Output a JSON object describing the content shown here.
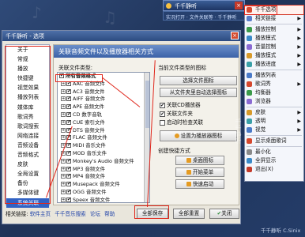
{
  "player": {
    "title": "千千静听",
    "lyric": "实况打开 · 文件关联等 · 千千静听"
  },
  "dialog": {
    "title": "千千静听 - 选项",
    "close": "×"
  },
  "nav": {
    "items": [
      {
        "label": "关于",
        "selected": false
      },
      {
        "label": "常规",
        "selected": false
      },
      {
        "label": "播放",
        "selected": false
      },
      {
        "label": "快捷键",
        "selected": false
      },
      {
        "label": "视觉效果",
        "selected": false
      },
      {
        "label": "播放列表",
        "selected": false
      },
      {
        "label": "媒体库",
        "selected": false
      },
      {
        "label": "歌词秀",
        "selected": false
      },
      {
        "label": "歌词搜索",
        "selected": false
      },
      {
        "label": "网络连接",
        "selected": false
      },
      {
        "label": "音频设备",
        "selected": false
      },
      {
        "label": "音频格式",
        "selected": false
      },
      {
        "label": "皮肤",
        "selected": false
      },
      {
        "label": "全局设置",
        "selected": false
      },
      {
        "label": "备份",
        "selected": false
      },
      {
        "label": "多媒体键",
        "selected": false
      },
      {
        "label": "系统关联",
        "selected": true
      }
    ]
  },
  "panel": {
    "header": "关联音频文件以及播放器相关方式",
    "types_label": "关联文件类型:",
    "icon_label": "当前文件类型的图标",
    "choose_icon": "选择文件图标",
    "restore_icon": "从文件夹里自动选择图标",
    "checks": [
      {
        "label": "关联CD播放器",
        "checked": true
      },
      {
        "label": "关联文件夹",
        "checked": true
      },
      {
        "label": "启动时检查关联",
        "checked": false
      }
    ],
    "headphone_btn": "设置为播放器图标",
    "shortcut_label": "创建快捷方式",
    "shortcut_desktop": "桌面图标",
    "shortcut_start": "开始菜单",
    "shortcut_quick": "快速启动",
    "list": [
      {
        "label": "所有音频格式",
        "top": true
      },
      {
        "label": "AAC 音频文件"
      },
      {
        "label": "AC3 音频文件"
      },
      {
        "label": "AIFF 音频文件"
      },
      {
        "label": "APE 音频文件"
      },
      {
        "label": "CD 数字音轨"
      },
      {
        "label": "CUE 索引文件"
      },
      {
        "label": "DTS 音频文件"
      },
      {
        "label": "FLAC 音频文件"
      },
      {
        "label": "MIDI 音乐文件"
      },
      {
        "label": "MOD 音乐文件"
      },
      {
        "label": "Monkey's Audio 音频文件"
      },
      {
        "label": "MP3 音频文件"
      },
      {
        "label": "MP4 音频文件"
      },
      {
        "label": "Musepack 音频文件"
      },
      {
        "label": "OGG 音频文件"
      },
      {
        "label": "Speex 音频文件"
      }
    ]
  },
  "footer": {
    "label": "相关链接:",
    "links": [
      "软件主页",
      "千千音乐搜索",
      "论坛",
      "帮助"
    ],
    "save_all": "全部保存",
    "reset_all": "全部重置",
    "close": "关闭"
  },
  "menu": {
    "items": [
      {
        "label": "千千选项",
        "arrow": false,
        "hl": true,
        "color": "#d6482e"
      },
      {
        "label": "相关链接",
        "arrow": true,
        "color": "#5a7dc8"
      },
      {
        "sep": true
      },
      {
        "label": "播放控制",
        "arrow": true,
        "color": "#3a9a4a"
      },
      {
        "label": "播放模式",
        "arrow": true,
        "color": "#3a8ac8"
      },
      {
        "label": "音量控制",
        "arrow": true,
        "color": "#8a6ad2"
      },
      {
        "label": "播放模式",
        "arrow": true,
        "color": "#d89a2a"
      },
      {
        "label": "播放进度",
        "arrow": true,
        "color": "#3aa0a8"
      },
      {
        "sep": true
      },
      {
        "label": "播放列表",
        "arrow": false,
        "color": "#4a7ac8"
      },
      {
        "label": "歌词秀",
        "arrow": true,
        "color": "#d6482e"
      },
      {
        "label": "均衡器",
        "arrow": false,
        "color": "#3a9a4a"
      },
      {
        "label": "浏览器",
        "arrow": false,
        "color": "#8a6ad2"
      },
      {
        "sep": true
      },
      {
        "label": "皮肤",
        "arrow": true,
        "color": "#d89a2a"
      },
      {
        "label": "透明",
        "arrow": true,
        "color": "#3aa0a8"
      },
      {
        "label": "视觉",
        "arrow": true,
        "color": "#4a7ac8"
      },
      {
        "sep": true
      },
      {
        "label": "显示桌面歌词",
        "arrow": false,
        "color": "#d6482e"
      },
      {
        "sep": true
      },
      {
        "label": "最小化",
        "arrow": false,
        "color": "#8a8a8a"
      },
      {
        "label": "全屏显示",
        "arrow": false,
        "color": "#3a8ac8"
      },
      {
        "label": "退出(X)",
        "arrow": false,
        "color": "#c43a2a"
      }
    ]
  },
  "watermark": "千千静听 C.Sinix",
  "vertical_brand": "千千静听"
}
